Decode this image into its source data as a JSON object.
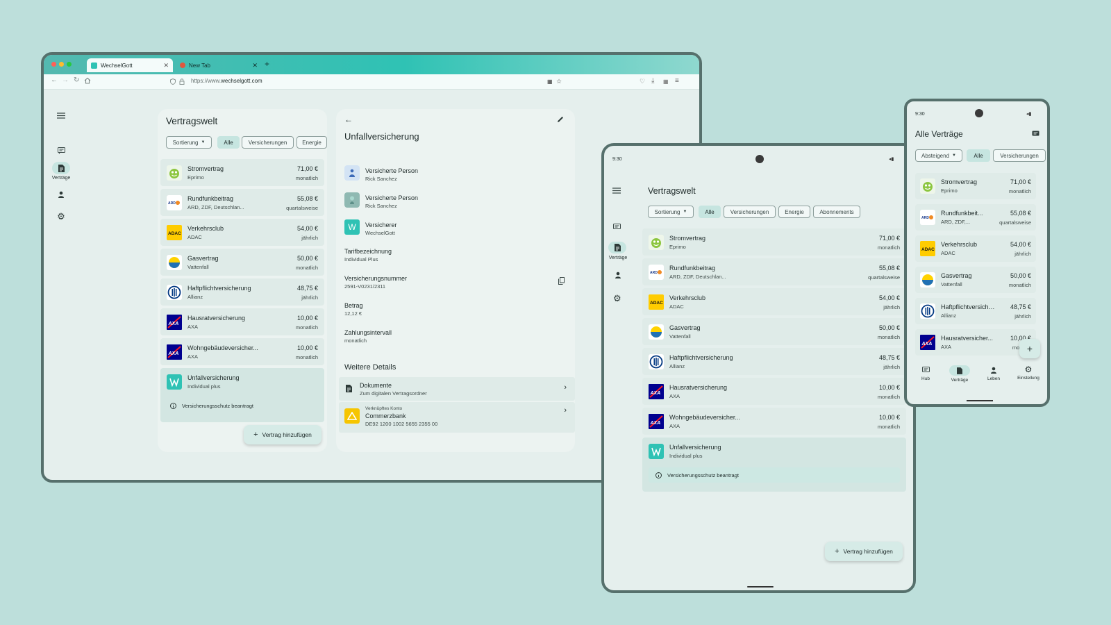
{
  "browser": {
    "tabs": [
      {
        "label": "WechselGott"
      },
      {
        "label": "New Tab"
      }
    ],
    "url_prefix": "https://www.",
    "url_domain": "wechselgott.com"
  },
  "desktop": {
    "rail": {
      "active_label": "Verträge"
    },
    "list_title": "Vertragswelt",
    "filters": {
      "sort": "Sortierung",
      "all": "Alle",
      "insurance": "Versicherungen",
      "energy": "Energie"
    },
    "contracts": [
      {
        "name": "Stromvertrag",
        "provider": "Eprimo",
        "amount": "71,00 €",
        "interval": "monatlich",
        "logo": "eprimo-logo"
      },
      {
        "name": "Rundfunkbeitrag",
        "provider": "ARD, ZDF, Deutschlan...",
        "amount": "55,08 €",
        "interval": "quartalsweise",
        "logo": "ard-zdf-logo"
      },
      {
        "name": "Verkehrsclub",
        "provider": "ADAC",
        "amount": "54,00 €",
        "interval": "jährlich",
        "logo": "adac-logo",
        "logo_text": "ADAC"
      },
      {
        "name": "Gasvertrag",
        "provider": "Vattenfall",
        "amount": "50,00 €",
        "interval": "monatlich",
        "logo": "vattenfall-logo"
      },
      {
        "name": "Haftpflichtversicherung",
        "provider": "Allianz",
        "amount": "48,75 €",
        "interval": "jährlich",
        "logo": "allianz-logo"
      },
      {
        "name": "Hausratversicherung",
        "provider": "AXA",
        "amount": "10,00 €",
        "interval": "monatlich",
        "logo": "axa-logo"
      },
      {
        "name": "Wohngebäudeversicher...",
        "provider": "AXA",
        "amount": "10,00 €",
        "interval": "monatlich",
        "logo": "axa-logo"
      },
      {
        "name": "Unfallversicherung",
        "provider": "Individual plus",
        "logo": "wechselgott-logo"
      }
    ],
    "selected_notice": "Versicherungsschutz beantragt",
    "add_button": "Vertrag hinzufügen",
    "detail": {
      "title": "Unfallversicherung",
      "people": [
        {
          "label": "Versicherte Person",
          "value": "Rick Sanchez"
        },
        {
          "label": "Versicherte Person",
          "value": "Rick Sanchez"
        },
        {
          "label": "Versicherer",
          "value": "WechselGott"
        }
      ],
      "fields": [
        {
          "label": "Tarifbezeichnung",
          "value": "Individual Plus"
        },
        {
          "label": "Versicherungsnummer",
          "value": "2591-V0231/2311"
        },
        {
          "label": "Betrag",
          "value": "12,12 €"
        },
        {
          "label": "Zahlungsintervall",
          "value": "monatlich"
        }
      ],
      "more_title": "Weitere Details",
      "documents": {
        "title": "Dokumente",
        "sub": "Zum digitalen Vertragsordner"
      },
      "account": {
        "caption": "Verknüpftes Konto",
        "bank": "Commerzbank",
        "iban": "DE92 1200 1002 5655 2355 00"
      }
    }
  },
  "tablet": {
    "time": "9:30",
    "title": "Vertragswelt",
    "rail_active_label": "Verträge",
    "filters": {
      "sort": "Sortierung",
      "all": "Alle",
      "insurance": "Versicherungen",
      "energy": "Energie",
      "subscriptions": "Abonnements"
    },
    "notice": "Versicherungsschutz beantragt",
    "add_button": "Vertrag hinzufügen"
  },
  "phone": {
    "time": "9:30",
    "title": "Alle Verträge",
    "filters": {
      "sort": "Absteigend",
      "all": "Alle",
      "insurance": "Versicherungen"
    },
    "contracts": [
      {
        "name": "Stromvertrag",
        "provider": "Eprimo",
        "amount": "71,00 €",
        "interval": "monatlich"
      },
      {
        "name": "Rundfunkbeit...",
        "provider": "ARD, ZDF,...",
        "amount": "55,08 €",
        "interval": "quartalsweise"
      },
      {
        "name": "Verkehrsclub",
        "provider": "ADAC",
        "amount": "54,00 €",
        "interval": "jährlich"
      },
      {
        "name": "Gasvertrag",
        "provider": "Vattenfall",
        "amount": "50,00 €",
        "interval": "monatlich"
      },
      {
        "name": "Haftpflichtversicher...",
        "provider": "Allianz",
        "amount": "48,75 €",
        "interval": "jährlich"
      },
      {
        "name": "Hausratversicher...",
        "provider": "AXA",
        "amount": "10,00 €",
        "interval": "monat..."
      }
    ],
    "nav": [
      {
        "label": "Hub"
      },
      {
        "label": "Verträge"
      },
      {
        "label": "Leben"
      },
      {
        "label": "Einstellung"
      }
    ]
  },
  "colors": {
    "accent": "#2fc2b4",
    "surface": "#e5efed",
    "card": "#dfebe8",
    "selected": "#c6e5e0",
    "frame": "#56706c",
    "background": "#bddfdb"
  }
}
